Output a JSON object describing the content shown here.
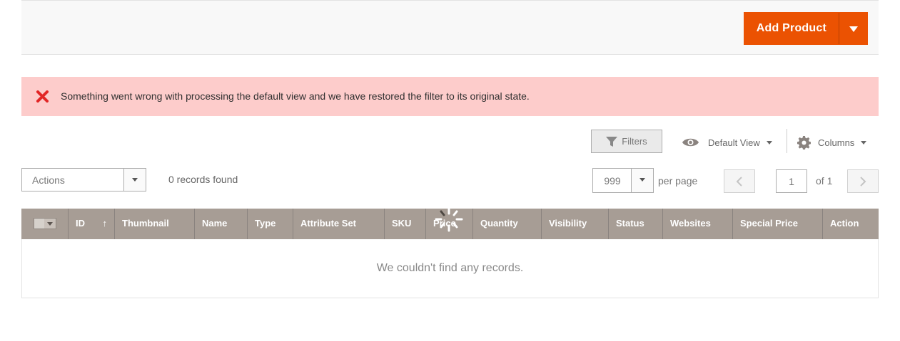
{
  "page_actions": {
    "add_product_label": "Add Product"
  },
  "message": {
    "text": "Something went wrong with processing the default view and we have restored the filter to its original state.",
    "icon": "error-x-icon",
    "background": "#fdcccb",
    "icon_color": "#e22626"
  },
  "toolbar": {
    "filters_label": "Filters",
    "view_label": "Default View",
    "columns_label": "Columns"
  },
  "mass_actions": {
    "selected": "Actions",
    "records_found": "0 records found"
  },
  "pager": {
    "per_page_value": "999",
    "per_page_label": "per page",
    "current_page": "1",
    "of_pages": "of 1"
  },
  "grid": {
    "columns": [
      "ID",
      "Thumbnail",
      "Name",
      "Type",
      "Attribute Set",
      "SKU",
      "Price",
      "Quantity",
      "Visibility",
      "Status",
      "Websites",
      "Special Price",
      "Action"
    ],
    "sort_indicator": "↑",
    "empty_text": "We couldn't find any records."
  },
  "colors": {
    "accent": "#eb5202",
    "grid_header": "#a79d95"
  }
}
